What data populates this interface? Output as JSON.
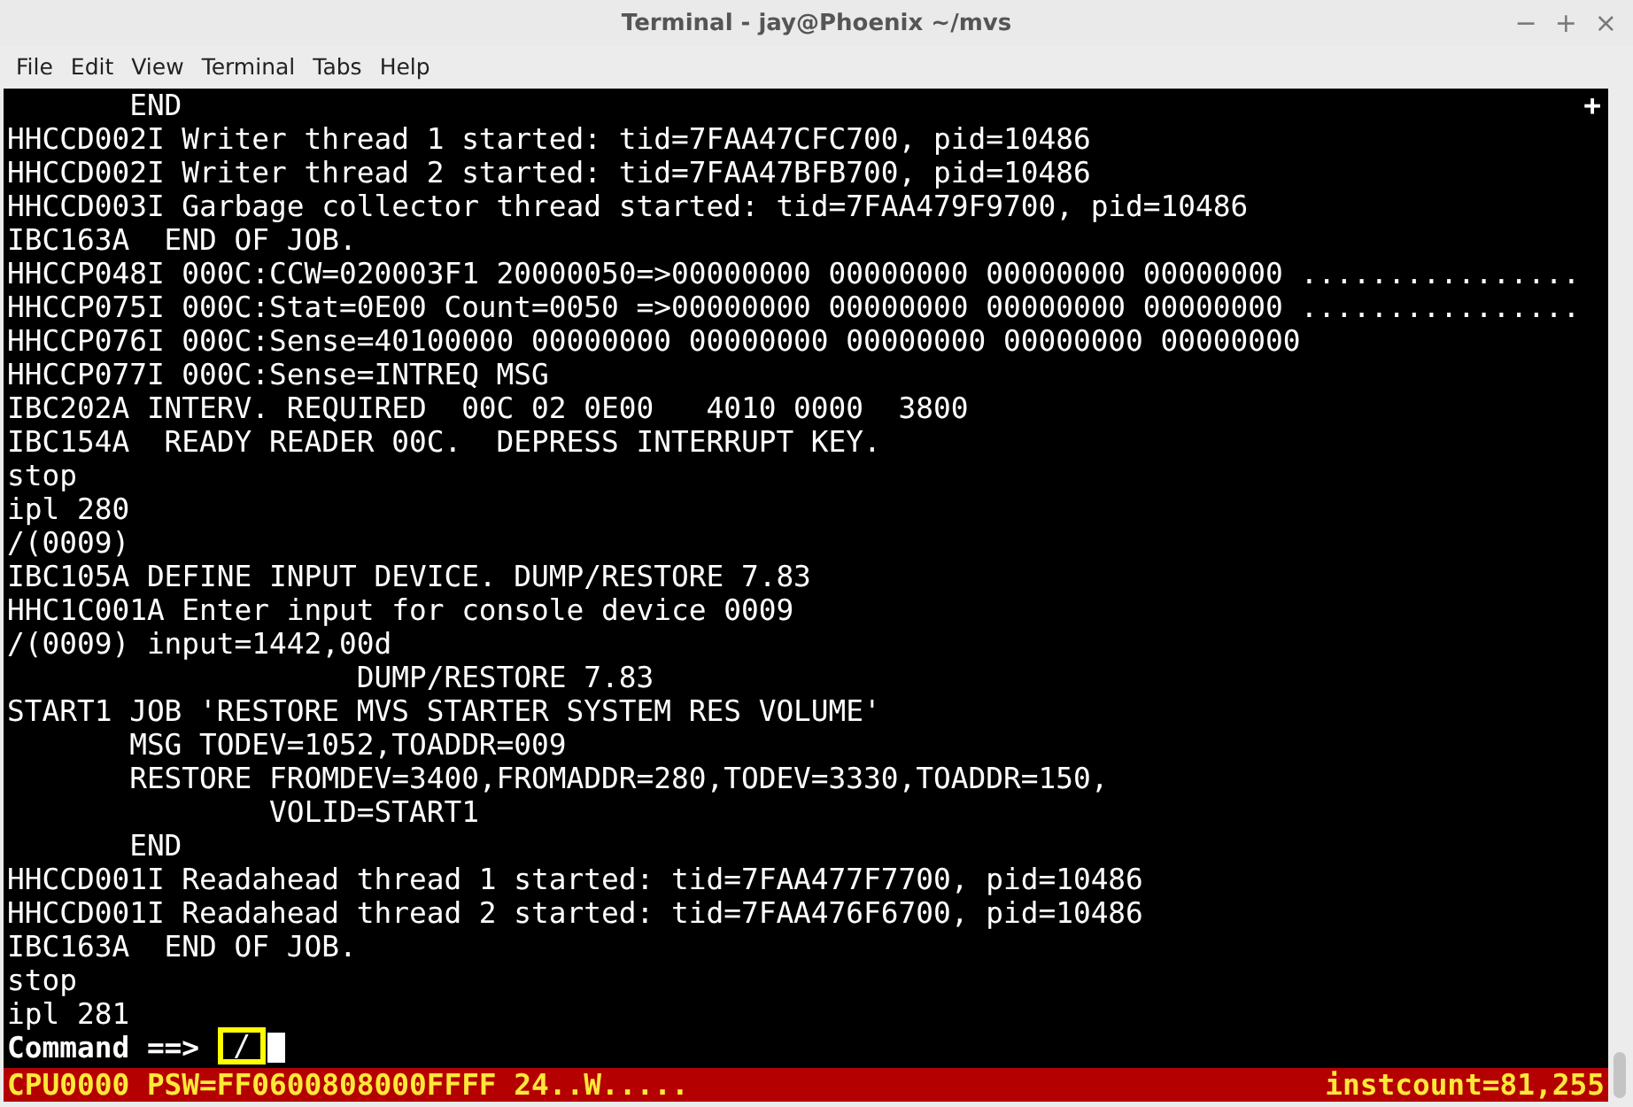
{
  "window": {
    "title": "Terminal - jay@Phoenix ~/mvs",
    "controls": [
      "−",
      "+",
      "×"
    ]
  },
  "menu": [
    "File",
    "Edit",
    "View",
    "Terminal",
    "Tabs",
    "Help"
  ],
  "terminal": {
    "corner_mark": "+",
    "lines": [
      "       END",
      "HHCCD002I Writer thread 1 started: tid=7FAA47CFC700, pid=10486",
      "HHCCD002I Writer thread 2 started: tid=7FAA47BFB700, pid=10486",
      "HHCCD003I Garbage collector thread started: tid=7FAA479F9700, pid=10486",
      "IBC163A  END OF JOB.",
      "HHCCP048I 000C:CCW=020003F1 20000050=>00000000 00000000 00000000 00000000 ................",
      "HHCCP075I 000C:Stat=0E00 Count=0050 =>00000000 00000000 00000000 00000000 ................",
      "HHCCP076I 000C:Sense=40100000 00000000 00000000 00000000 00000000 00000000",
      "HHCCP077I 000C:Sense=INTREQ MSG",
      "IBC202A INTERV. REQUIRED  00C 02 0E00   4010 0000  3800",
      "IBC154A  READY READER 00C.  DEPRESS INTERRUPT KEY.",
      "stop",
      "ipl 280",
      "/(0009)",
      "IBC105A DEFINE INPUT DEVICE. DUMP/RESTORE 7.83",
      "HHC1C001A Enter input for console device 0009",
      "/(0009) input=1442,00d",
      "                    DUMP/RESTORE 7.83",
      "START1 JOB 'RESTORE MVS STARTER SYSTEM RES VOLUME'",
      "       MSG TODEV=1052,TOADDR=009",
      "       RESTORE FROMDEV=3400,FROMADDR=280,TODEV=3330,TOADDR=150,",
      "               VOLID=START1",
      "       END",
      "HHCCD001I Readahead thread 1 started: tid=7FAA477F7700, pid=10486",
      "HHCCD001I Readahead thread 2 started: tid=7FAA476F6700, pid=10486",
      "IBC163A  END OF JOB.",
      "stop",
      "ipl 281"
    ],
    "prompt": "Command ==>",
    "command_input": "/"
  },
  "status_bar": {
    "left": "CPU0000 PSW=FF0600808000FFFF 24..W.....",
    "right": "instcount=81,255"
  }
}
